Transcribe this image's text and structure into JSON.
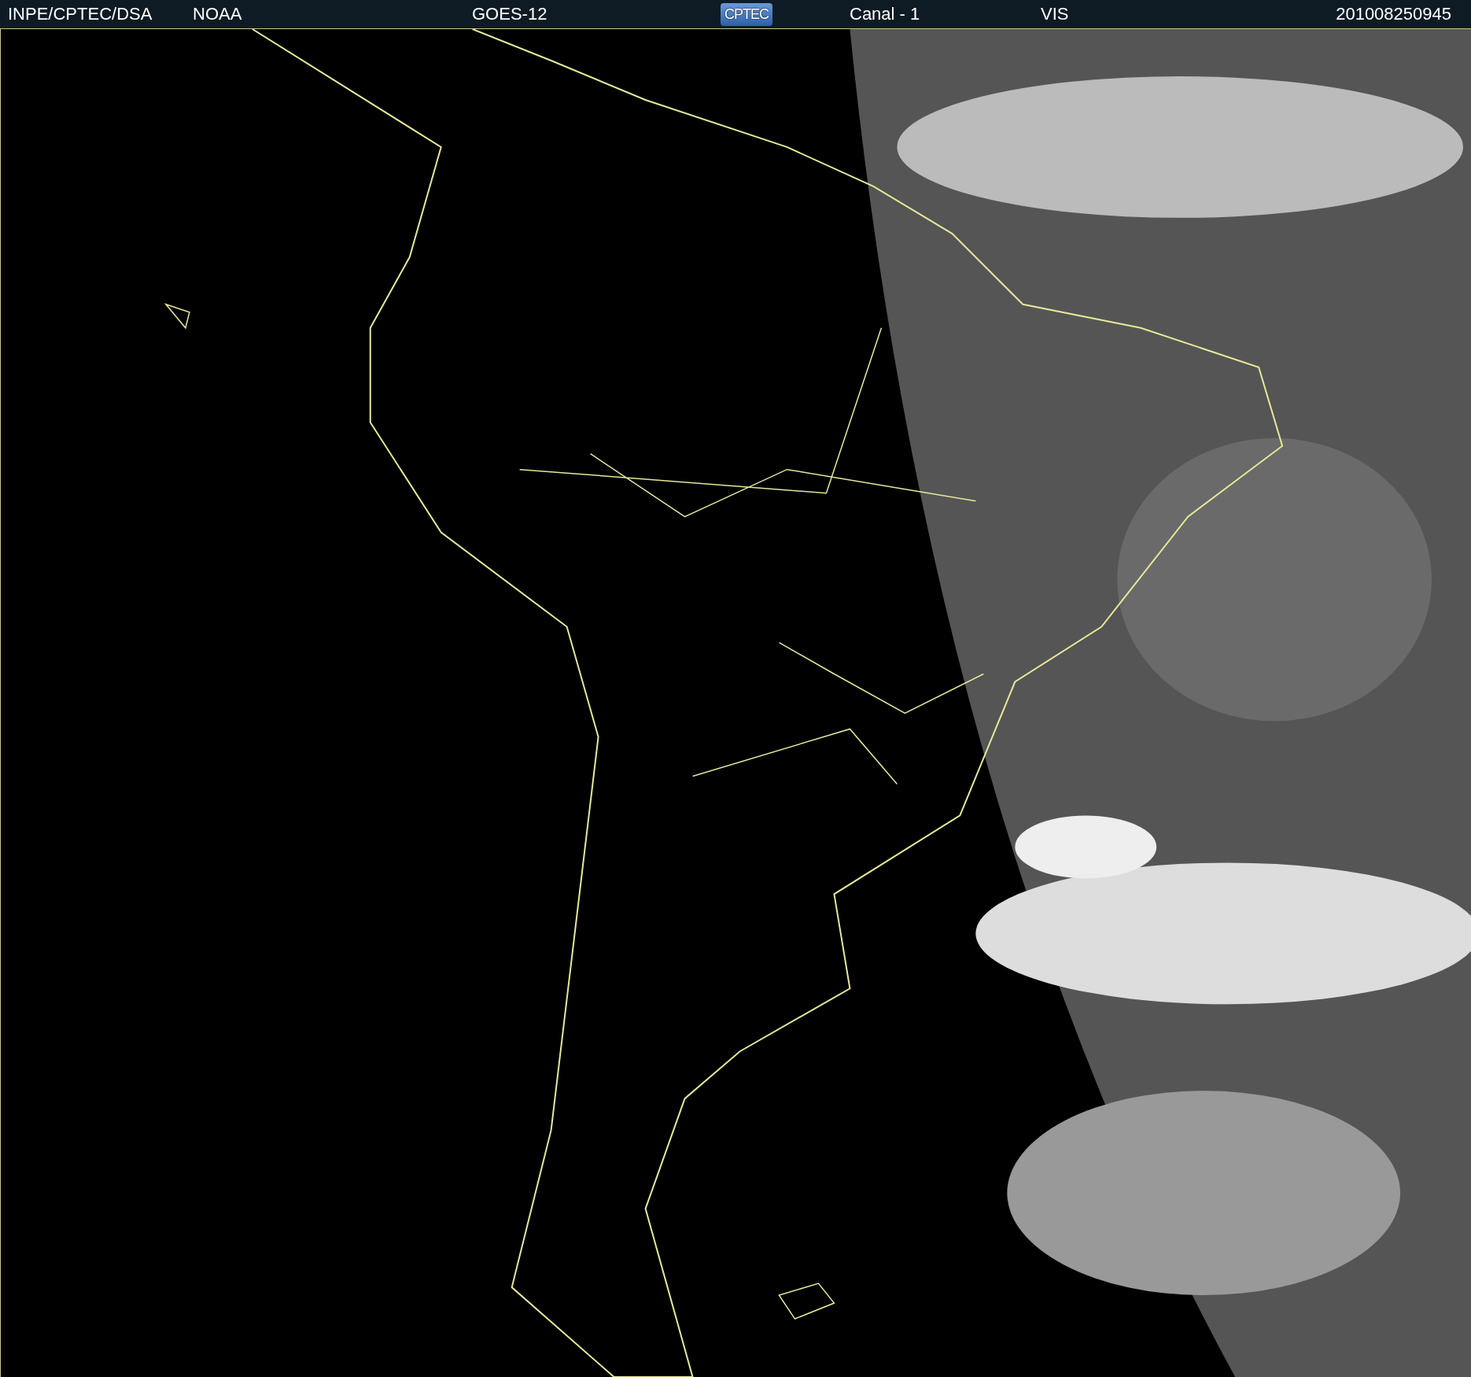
{
  "header": {
    "agency": "INPE/CPTEC/DSA",
    "operator": "NOAA",
    "satellite": "GOES-12",
    "logo": "CPTEC",
    "channel": "Canal - 1",
    "band": "VIS",
    "timestamp": "201008250945"
  }
}
